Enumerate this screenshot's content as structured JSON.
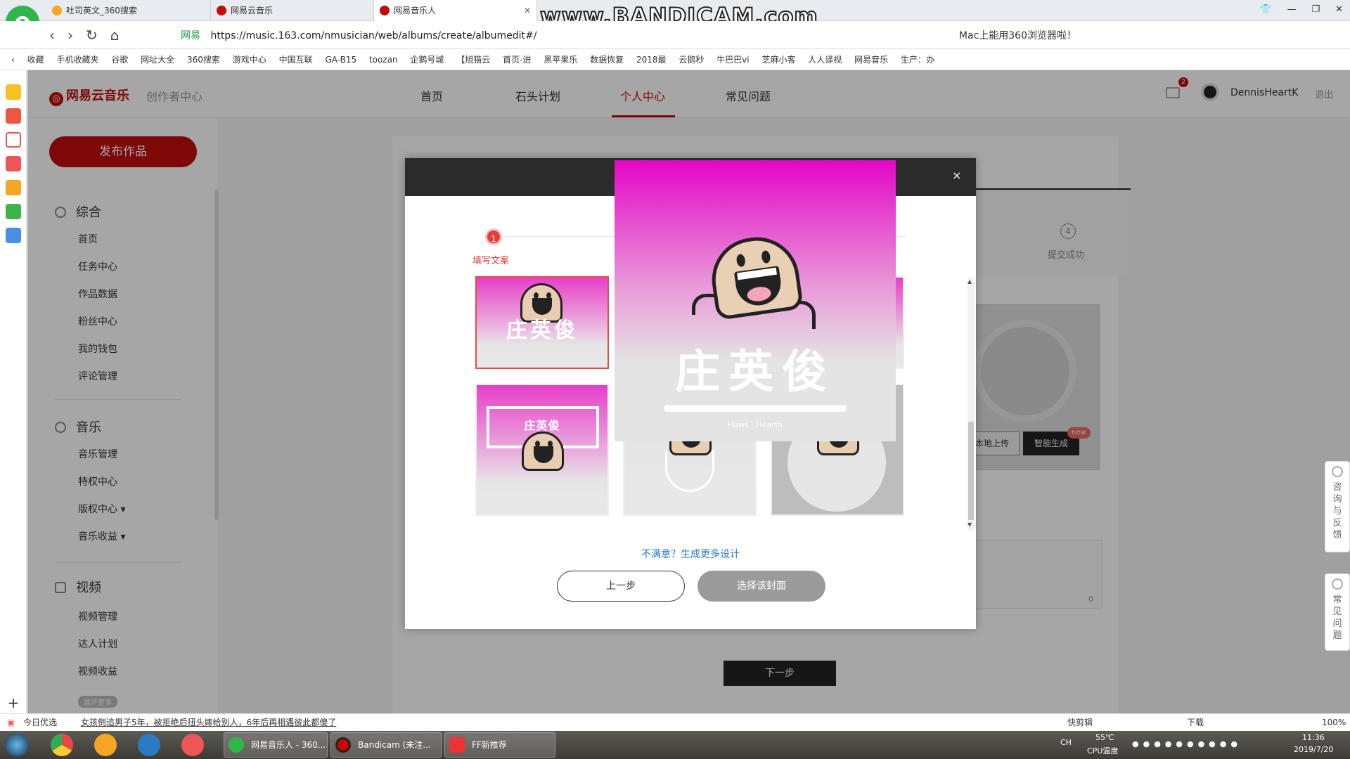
{
  "browser": {
    "tabs": [
      {
        "label": "吐司英文_360搜索",
        "color": "#f5a623"
      },
      {
        "label": "网易云音乐",
        "color": "#c20c0c"
      },
      {
        "label": "网易音乐人",
        "color": "#c20c0c"
      }
    ],
    "logo_glyph": "e",
    "watermark": "www.BANDICAM.com",
    "url_site": "网易",
    "url": "https://music.163.com/nmusician/web/albums/create/albumedit#/",
    "url_right_text": "Mac上能用360浏览器啦！",
    "bookmarks": [
      "收藏",
      "手机收藏夹",
      "谷歌",
      "网址大全",
      "360搜索",
      "游戏中心",
      "中国互联",
      "GA-B15",
      "toozan",
      "企鹅号城",
      "【旭猫云",
      "首页-进",
      "黑苹果乐",
      "数据恢复",
      "2018最",
      "云鹅秒",
      "牛巴巴vi",
      "芝麻小客",
      "人人译视",
      "网易音乐",
      "生产：办"
    ]
  },
  "site": {
    "brand": "网易云音乐",
    "creator_center": "创作者中心",
    "nav": [
      "首页",
      "石头计划",
      "个人中心",
      "常见问题"
    ],
    "mail_badge": "2",
    "username": "DennisHeartK",
    "logout": "退出"
  },
  "sidebar": {
    "publish": "发布作品",
    "sections": [
      {
        "title": "综合",
        "items": [
          "首页",
          "任务中心",
          "作品数据",
          "粉丝中心",
          "我的钱包",
          "评论管理"
        ]
      },
      {
        "title": "音乐",
        "items": [
          "音乐管理",
          "特权中心",
          "版权中心 ▾",
          "音乐收益 ▾"
        ]
      },
      {
        "title": "视频",
        "items": [
          "视频管理",
          "达人计划",
          "视频收益"
        ]
      }
    ],
    "expand_more": "展开更多"
  },
  "main": {
    "step4_number": "4",
    "step4_label": "提交成功",
    "local_upload": "本地上传",
    "smart_generate": "智能生成",
    "new_badge": "new",
    "textarea_count": "0",
    "next_step": "下一步"
  },
  "modal": {
    "close": "×",
    "step1_number": "1",
    "step1_label": "填写文案",
    "step3_label_partial": "面",
    "cover_title": "庄英俊",
    "cover_subtitle": "Haws · Hearth",
    "more_designs": "不满意？生成更多设计",
    "prev_button": "上一步",
    "choose_button": "选择该封面"
  },
  "float_panel": {
    "feedback": "咨询与反馈",
    "faq": "常见问题"
  },
  "statusbar": {
    "left": "今日优选",
    "news": "女孩倒追男子5年，被拒绝后扭头嫁给别人，6年后再相遇彼此都傻了",
    "right_items": [
      "快剪辑",
      "下载",
      "100%"
    ]
  },
  "taskbar": {
    "apps": [
      "网易音乐人 - 360...",
      "Bandicam (未注...",
      "FF新推荐"
    ],
    "lang": "CH",
    "cpu_temp": "55℃",
    "cpu_label": "CPU温度",
    "time": "11:36",
    "date": "2019/7/20"
  }
}
